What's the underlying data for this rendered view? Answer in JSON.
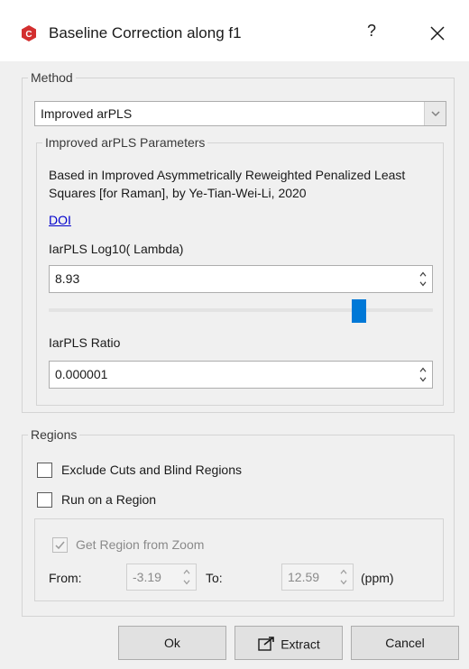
{
  "window": {
    "title": "Baseline Correction along f1",
    "help_label": "?"
  },
  "method": {
    "legend": "Method",
    "selected": "Improved arPLS",
    "params": {
      "legend": "Improved arPLS Parameters",
      "description": "Based in Improved Asymmetrically Reweighted Penalized Least Squares [for Raman], by Ye-Tian-Wei-Li, 2020",
      "doi_label": "DOI",
      "lambda_label": "IarPLS Log10( Lambda)",
      "lambda_value": "8.93",
      "slider_fraction": 0.82,
      "ratio_label": "IarPLS Ratio",
      "ratio_value": "0.000001"
    }
  },
  "regions": {
    "legend": "Regions",
    "exclude_label": "Exclude Cuts and Blind Regions",
    "exclude_checked": false,
    "run_label": "Run on a Region",
    "run_checked": false,
    "zoom_label": "Get Region from Zoom",
    "zoom_checked": true,
    "from_label": "From:",
    "from_value": "-3.19",
    "to_label": "To:",
    "to_value": "12.59",
    "unit_label": "(ppm)"
  },
  "buttons": {
    "ok": "Ok",
    "extract": "Extract",
    "cancel": "Cancel"
  },
  "colors": {
    "accent": "#0078d7",
    "app_icon": "#d32f2f",
    "link": "#0000cc"
  }
}
